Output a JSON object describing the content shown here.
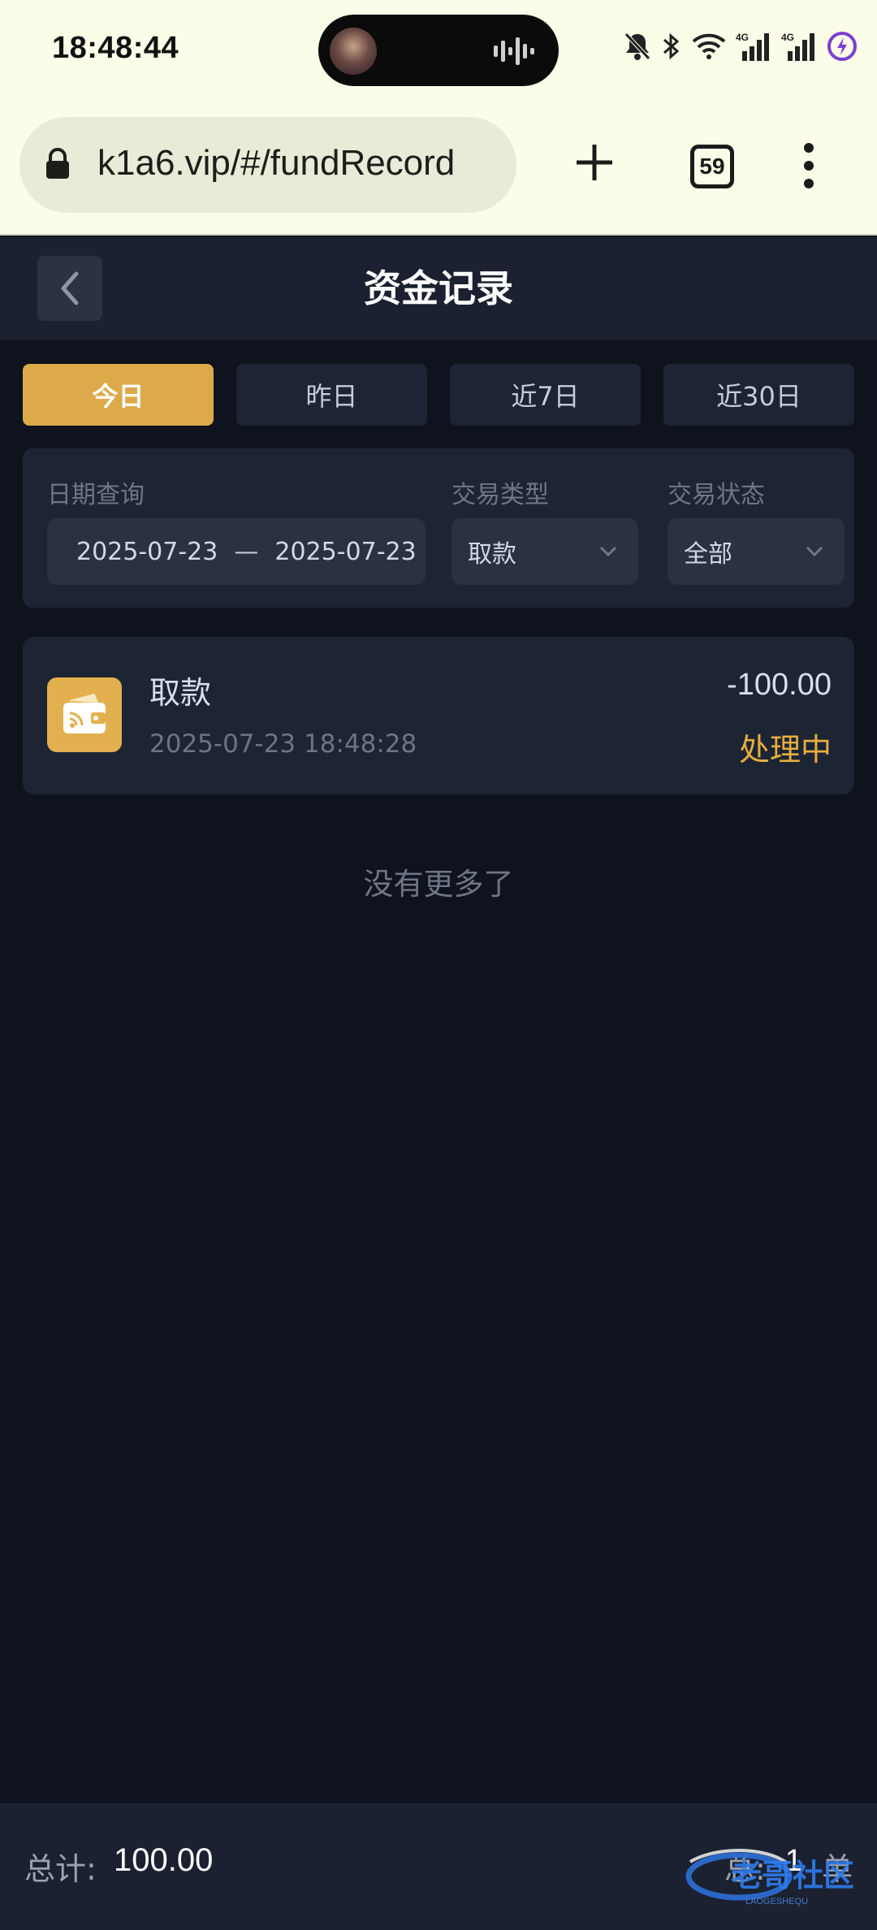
{
  "status_bar": {
    "time": "18:48:44",
    "network_1": "4G",
    "network_2": "4G"
  },
  "browser": {
    "url": "k1a6.vip/#/fundRecord",
    "tab_count": "59"
  },
  "header": {
    "title": "资金记录"
  },
  "date_tabs": [
    {
      "label": "今日",
      "active": true
    },
    {
      "label": "昨日",
      "active": false
    },
    {
      "label": "近7日",
      "active": false
    },
    {
      "label": "近30日",
      "active": false
    }
  ],
  "filter": {
    "date_label": "日期查询",
    "date_start": "2025-07-23",
    "date_separator": "—",
    "date_end": "2025-07-23",
    "type_label": "交易类型",
    "type_value": "取款",
    "status_label": "交易状态",
    "status_value": "全部"
  },
  "records": [
    {
      "type": "取款",
      "time": "2025-07-23 18:48:28",
      "amount": "-100.00",
      "status": "处理中",
      "icon": "wallet-icon"
    }
  ],
  "list_end_text": "没有更多了",
  "footer": {
    "total_label": "总计:",
    "total_value": "100.00",
    "count_prefix": "总:",
    "count_value": "1",
    "count_suffix": "单"
  },
  "colors": {
    "accent": "#dcaa4a",
    "status_pending": "#e6ad3f",
    "background": "#0f131d",
    "card": "#1d2434"
  }
}
